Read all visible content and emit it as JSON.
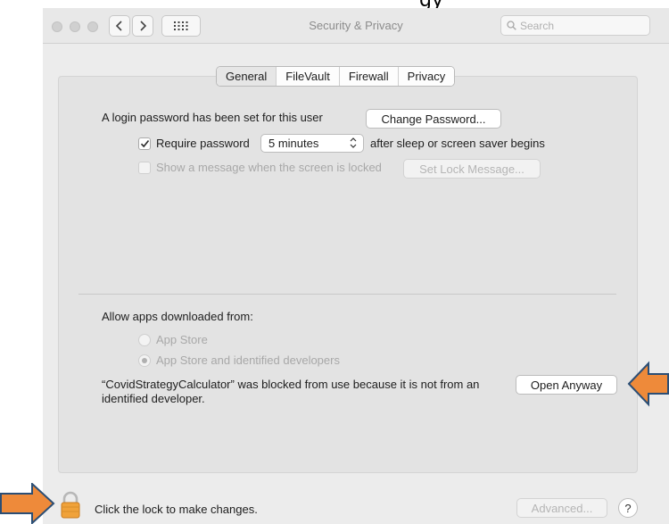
{
  "window": {
    "title": "Security & Privacy",
    "top_cut_text": "gy",
    "search_placeholder": "Search"
  },
  "tabs": [
    "General",
    "FileVault",
    "Firewall",
    "Privacy"
  ],
  "selected_tab": "General",
  "general": {
    "login_text": "A login password has been set for this user",
    "change_password_label": "Change Password...",
    "require_password_label": "Require password",
    "require_password_checked": true,
    "require_password_delay": "5 minutes",
    "after_sleep_text": "after sleep or screen saver begins",
    "show_message_label": "Show a message when the screen is locked",
    "show_message_checked": false,
    "set_lock_message_label": "Set Lock Message..."
  },
  "downloads": {
    "heading": "Allow apps downloaded from:",
    "option_app_store": "App Store",
    "option_identified": "App Store and identified developers",
    "selected": "App Store and identified developers",
    "blocked_message": "“CovidStrategyCalculator” was blocked from use because it is not from an identified developer.",
    "open_anyway_label": "Open Anyway"
  },
  "footer": {
    "lock_text": "Click the lock to make changes.",
    "advanced_label": "Advanced...",
    "help_label": "?"
  },
  "colors": {
    "arrow": "#ee8a3a",
    "lock": "#f0a23a"
  },
  "icons": {
    "arrow_left": "arrow-left-icon",
    "arrow_right": "arrow-right-icon",
    "lock": "lock-icon",
    "search": "search-icon",
    "grid": "grid-icon"
  }
}
